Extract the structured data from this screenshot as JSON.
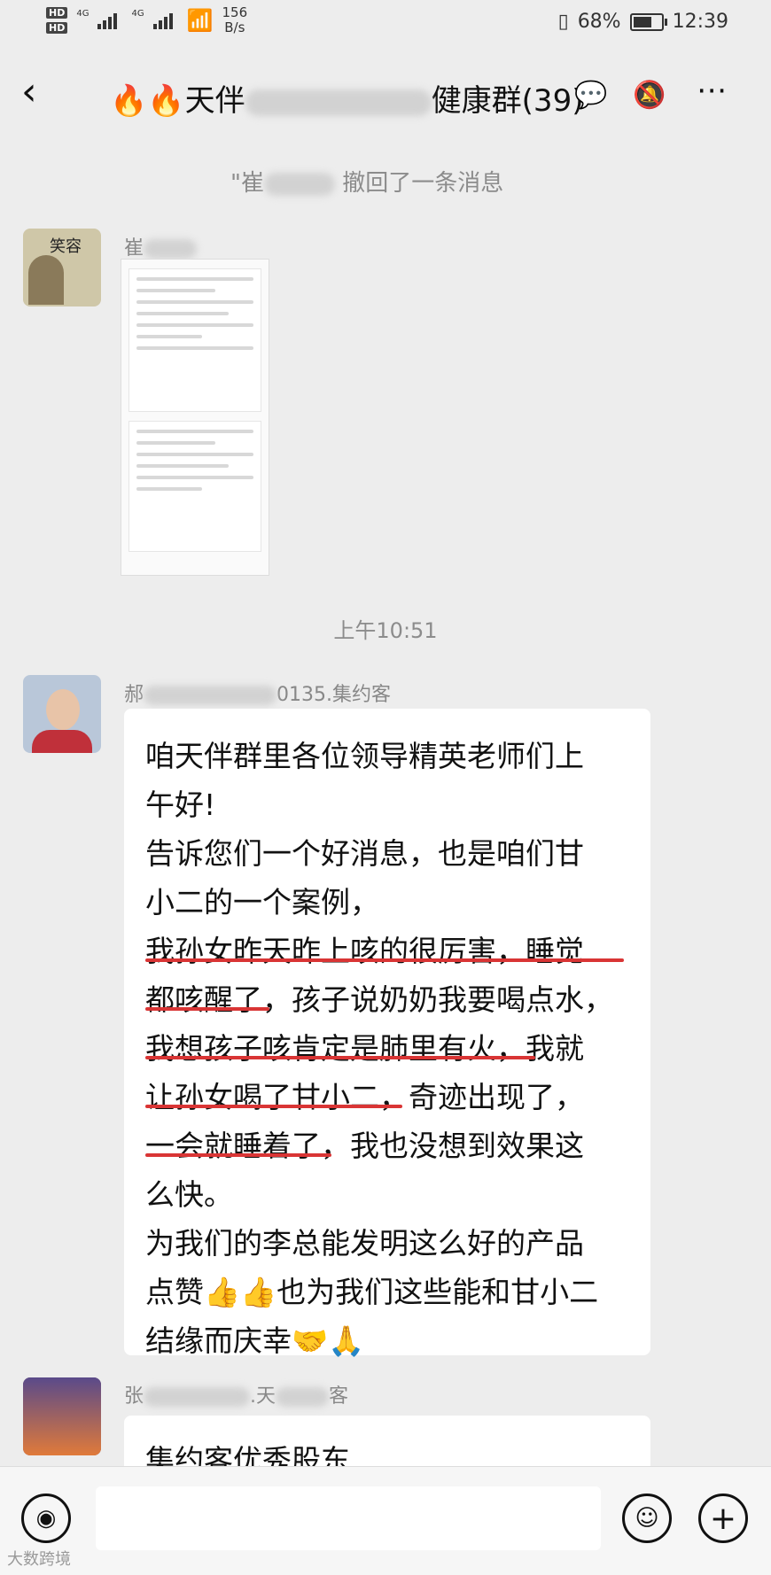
{
  "status_bar": {
    "hd1": "HD",
    "hd2": "HD",
    "net1": "4G",
    "net2": "4G",
    "speed_value": "156",
    "speed_unit": "B/s",
    "battery": "68%",
    "time": "12:39"
  },
  "header": {
    "title_prefix": "🔥🔥天伴",
    "title_suffix": "健康群(39)",
    "back_icon": "‹"
  },
  "recall": {
    "prefix": "\"崔",
    "text": "撤回了一条消息"
  },
  "messages": [
    {
      "sender_prefix": "崔"
    },
    {
      "timestamp": "上午10:51",
      "sender_prefix": "郝",
      "sender_suffix": "0135.集约客",
      "text": "咱天伴群里各位领导精英老师们上\n午好!\n告诉您们一个好消息，也是咱们甘\n小二的一个案例，\n我孙女昨天昨上咳的很厉害，睡觉\n都咳醒了，孩子说奶奶我要喝点水，\n我想孩子咳肯定是肺里有火，我就\n让孙女喝了甘小二，奇迹出现了，\n一会就睡着了，我也没想到效果这\n么快。\n为我们的李总能发明这么好的产品\n点赞👍👍也为我们这些能和甘小二\n结缘而庆幸🤝🙏"
    },
    {
      "sender_prefix": "张",
      "sender_middle": ".天",
      "sender_suffix": "客",
      "text": "集约客优秀股东"
    }
  ],
  "avatar1_text": "笑容",
  "watermark": "大数跨境",
  "colors": {
    "underline": "#d93535",
    "background": "#ededed"
  }
}
